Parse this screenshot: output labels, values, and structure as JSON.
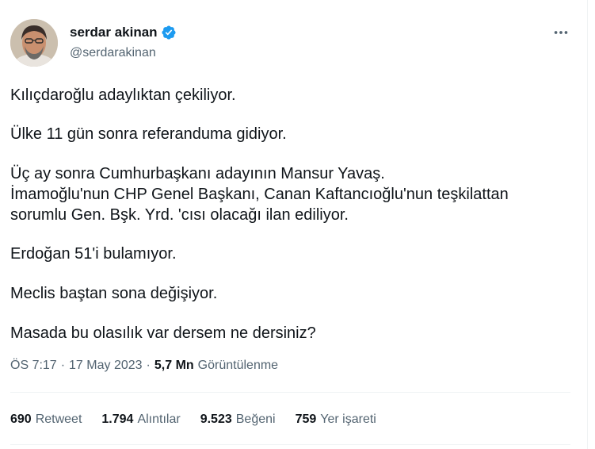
{
  "author": {
    "name": "serdar akinan",
    "handle": "@serdarakinan",
    "verified_color": "#1d9bf0"
  },
  "more_icon": "more-horizontal-icon",
  "tweet": {
    "lines": [
      "Kılıçdaroğlu adaylıktan çekiliyor.",
      "Ülke 11 gün sonra referanduma gidiyor.",
      "Üç ay sonra Cumhurbaşkanı adayının Mansur Yavaş.",
      "İmamoğlu'nun CHP Genel Başkanı, Canan Kaftancıoğlu'nun teşkilattan",
      "sorumlu Gen. Bşk. Yrd. 'cısı olacağı ilan ediliyor.",
      "Erdoğan 51'i bulamıyor.",
      "Meclis baştan sona değişiyor.",
      "Masada bu olasılık var dersem ne dersiniz?"
    ]
  },
  "meta": {
    "time": "ÖS 7:17",
    "sep1": "·",
    "date": "17 May 2023",
    "sep2": "·",
    "views": "5,7 Mn",
    "views_label": "Görüntülenme"
  },
  "stats": {
    "retweets": "690",
    "retweets_label": "Retweet",
    "quotes": "1.794",
    "quotes_label": "Alıntılar",
    "likes": "9.523",
    "likes_label": "Beğeni",
    "bookmarks": "759",
    "bookmarks_label": "Yer işareti"
  }
}
